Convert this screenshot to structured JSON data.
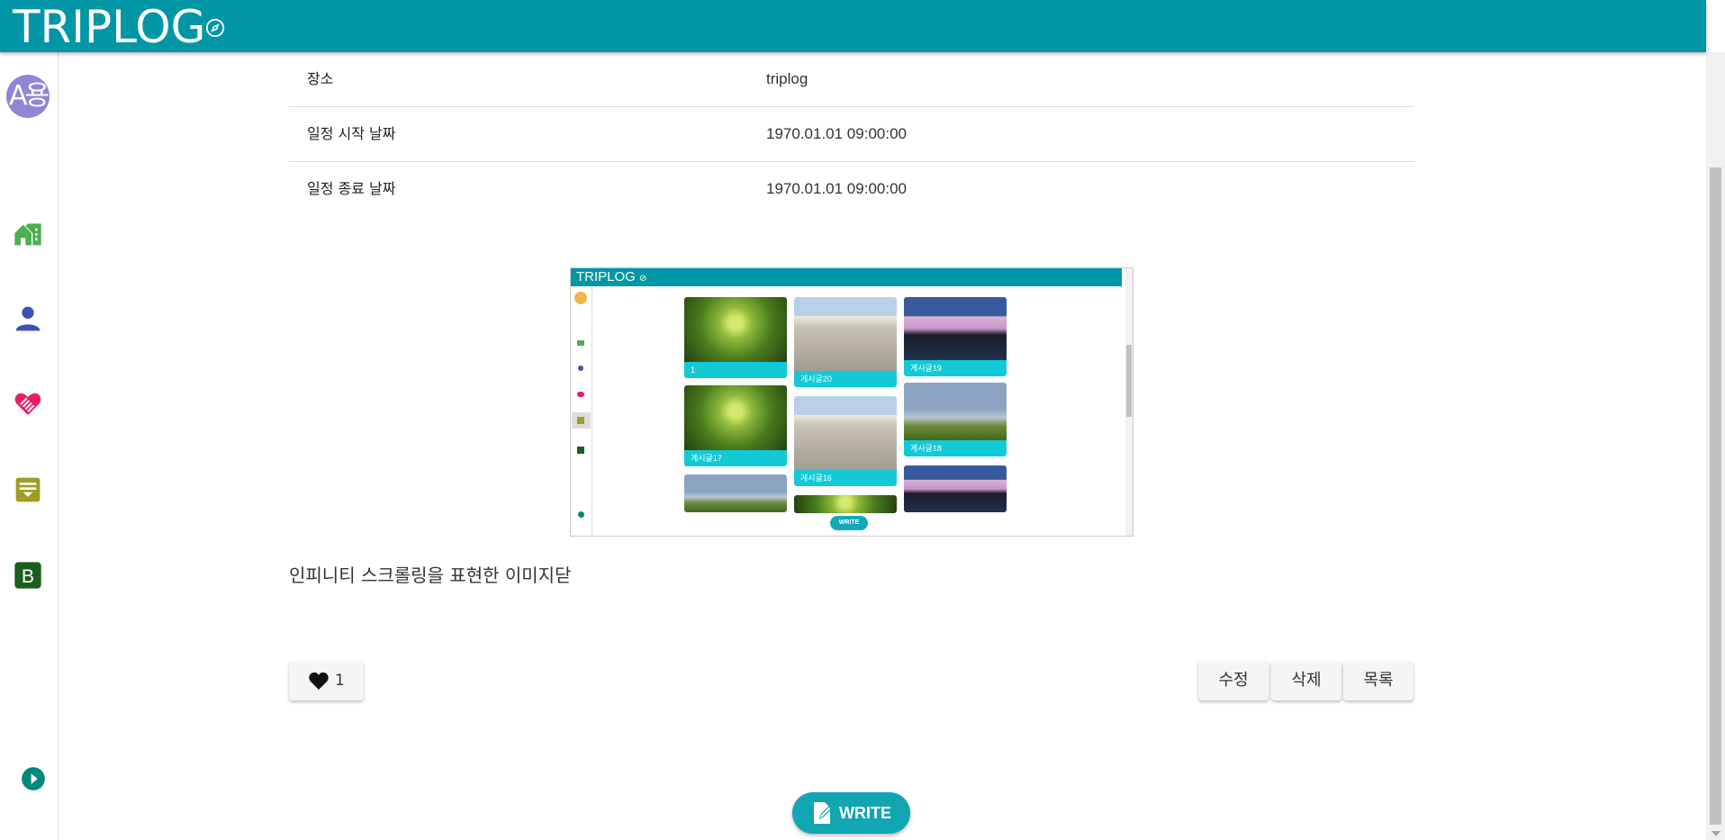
{
  "header": {
    "logo": "TRIPLOG",
    "brand_color": "#0096a6"
  },
  "sidebar": {
    "avatar_text": "A용",
    "items": [
      {
        "icon": "home-icon",
        "color": "#4caf50"
      },
      {
        "icon": "person-icon",
        "color": "#3f51b5"
      },
      {
        "icon": "heart-handshake-icon",
        "color": "#e91e63"
      },
      {
        "icon": "note-icon",
        "color": "#9e9d24"
      },
      {
        "icon": "b-icon",
        "color": "#1b5e20"
      },
      {
        "icon": "play-circle-icon",
        "color": "#00897b"
      }
    ]
  },
  "details": [
    {
      "label": "장소",
      "value": "triplog"
    },
    {
      "label": "일정 시작 날짜",
      "value": "1970.01.01 09:00:00"
    },
    {
      "label": "일정 종료 날짜",
      "value": "1970.01.01 09:00:00"
    }
  ],
  "post_image": {
    "logo": "TRIPLOG",
    "cards": [
      "1",
      "게시글20",
      "게시글19",
      "게시글17",
      "게시글16",
      "게시글18"
    ],
    "write_label": "WRITE"
  },
  "description": "인피니티 스크롤링을 표현한 이미지닫",
  "like": {
    "count": "1"
  },
  "actions": {
    "edit": "수정",
    "delete": "삭제",
    "list": "목록"
  },
  "write_button": "WRITE"
}
